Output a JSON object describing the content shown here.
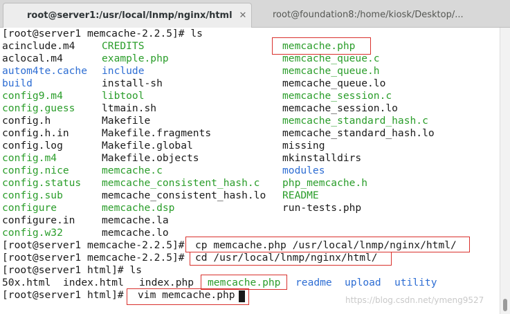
{
  "tabs": [
    {
      "title": "root@server1:/usr/local/lnmp/nginx/html",
      "close": "✕"
    },
    {
      "title": "root@foundation8:/home/kiosk/Desktop/..."
    }
  ],
  "terminal": {
    "lines": [
      {
        "cols": [
          {
            "text": "[root@server1 memcache-2.2.5]# ls",
            "c": "t"
          }
        ]
      },
      {
        "cols": [
          {
            "text": "acinclude.m4",
            "c": "t"
          },
          {
            "text": "CREDITS",
            "c": "g"
          },
          {
            "text": "memcache.php",
            "c": "g"
          }
        ]
      },
      {
        "cols": [
          {
            "text": "aclocal.m4",
            "c": "t"
          },
          {
            "text": "example.php",
            "c": "g"
          },
          {
            "text": "memcache_queue.c",
            "c": "g"
          }
        ]
      },
      {
        "cols": [
          {
            "text": "autom4te.cache",
            "c": "b"
          },
          {
            "text": "include",
            "c": "b"
          },
          {
            "text": "memcache_queue.h",
            "c": "g"
          }
        ]
      },
      {
        "cols": [
          {
            "text": "build",
            "c": "b"
          },
          {
            "text": "install-sh",
            "c": "t"
          },
          {
            "text": "memcache_queue.lo",
            "c": "t"
          }
        ]
      },
      {
        "cols": [
          {
            "text": "config9.m4",
            "c": "g"
          },
          {
            "text": "libtool",
            "c": "g"
          },
          {
            "text": "memcache_session.c",
            "c": "g"
          }
        ]
      },
      {
        "cols": [
          {
            "text": "config.guess",
            "c": "g"
          },
          {
            "text": "ltmain.sh",
            "c": "t"
          },
          {
            "text": "memcache_session.lo",
            "c": "t"
          }
        ]
      },
      {
        "cols": [
          {
            "text": "config.h",
            "c": "t"
          },
          {
            "text": "Makefile",
            "c": "t"
          },
          {
            "text": "memcache_standard_hash.c",
            "c": "g"
          }
        ]
      },
      {
        "cols": [
          {
            "text": "config.h.in",
            "c": "t"
          },
          {
            "text": "Makefile.fragments",
            "c": "t"
          },
          {
            "text": "memcache_standard_hash.lo",
            "c": "t"
          }
        ]
      },
      {
        "cols": [
          {
            "text": "config.log",
            "c": "t"
          },
          {
            "text": "Makefile.global",
            "c": "t"
          },
          {
            "text": "missing",
            "c": "t"
          }
        ]
      },
      {
        "cols": [
          {
            "text": "config.m4",
            "c": "g"
          },
          {
            "text": "Makefile.objects",
            "c": "t"
          },
          {
            "text": "mkinstalldirs",
            "c": "t"
          }
        ]
      },
      {
        "cols": [
          {
            "text": "config.nice",
            "c": "g"
          },
          {
            "text": "memcache.c",
            "c": "g"
          },
          {
            "text": "modules",
            "c": "b"
          }
        ]
      },
      {
        "cols": [
          {
            "text": "config.status",
            "c": "g"
          },
          {
            "text": "memcache_consistent_hash.c",
            "c": "g"
          },
          {
            "text": "php_memcache.h",
            "c": "g"
          }
        ]
      },
      {
        "cols": [
          {
            "text": "config.sub",
            "c": "g"
          },
          {
            "text": "memcache_consistent_hash.lo",
            "c": "t"
          },
          {
            "text": "README",
            "c": "g"
          }
        ]
      },
      {
        "cols": [
          {
            "text": "configure",
            "c": "g"
          },
          {
            "text": "memcache.dsp",
            "c": "g"
          },
          {
            "text": "run-tests.php",
            "c": "t"
          }
        ]
      },
      {
        "cols": [
          {
            "text": "configure.in",
            "c": "t"
          },
          {
            "text": "memcache.la",
            "c": "t"
          }
        ]
      },
      {
        "cols": [
          {
            "text": "config.w32",
            "c": "g"
          },
          {
            "text": "memcache.lo",
            "c": "t"
          }
        ]
      },
      {
        "cols": [
          {
            "text": "[root@server1 memcache-2.2.5]#",
            "c": "t"
          },
          {
            "text": "cp memcache.php /usr/local/lnmp/nginx/html/",
            "c": "t"
          }
        ]
      },
      {
        "cols": [
          {
            "text": "[root@server1 memcache-2.2.5]#",
            "c": "t"
          },
          {
            "text": "cd /usr/local/lnmp/nginx/html/",
            "c": "t"
          }
        ]
      },
      {
        "cols": [
          {
            "text": "[root@server1 html]# ls",
            "c": "t"
          }
        ]
      },
      {
        "cols": [
          {
            "text": "50x.html",
            "c": "t"
          },
          {
            "text": "index.html",
            "c": "t"
          },
          {
            "text": "index.php",
            "c": "t"
          },
          {
            "text": "memcache.php",
            "c": "g"
          },
          {
            "text": "readme",
            "c": "b"
          },
          {
            "text": "upload",
            "c": "b"
          },
          {
            "text": "utility",
            "c": "b"
          }
        ]
      },
      {
        "cols": [
          {
            "text": "[root@server1 html]#",
            "c": "t"
          },
          {
            "text": "vim memcache.php",
            "c": "t"
          }
        ]
      }
    ]
  },
  "watermark": "https://blog.csdn.net/ymeng9527",
  "colors": {
    "green": "#2a9d2a",
    "blue": "#2d6dd3",
    "text": "#1a1a1a",
    "highlight_box": "#d9302c"
  }
}
